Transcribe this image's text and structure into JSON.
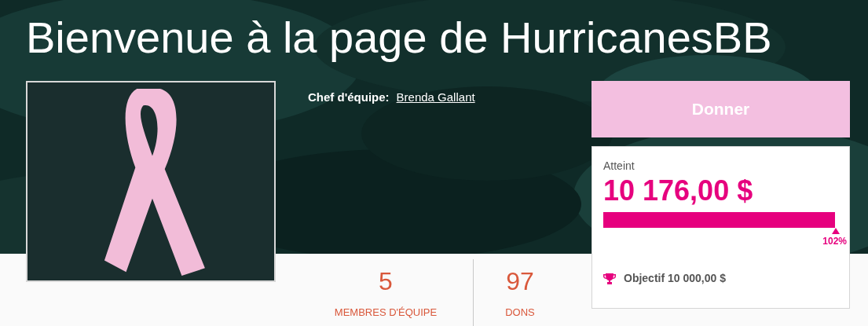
{
  "title": "Bienvenue à la page de HurricanesBB",
  "team_lead": {
    "label": "Chef d'équipe:",
    "name": "Brenda Gallant"
  },
  "stats": [
    {
      "value": "5",
      "label": "MEMBRES D'ÉQUIPE"
    },
    {
      "value": "97",
      "label": "DONS"
    }
  ],
  "donate_button": "Donner",
  "progress": {
    "label": "Atteint",
    "amount": "10 176,00 $",
    "level": 1,
    "percent": "102%",
    "goal": "Objectif 10 000,00 $"
  }
}
